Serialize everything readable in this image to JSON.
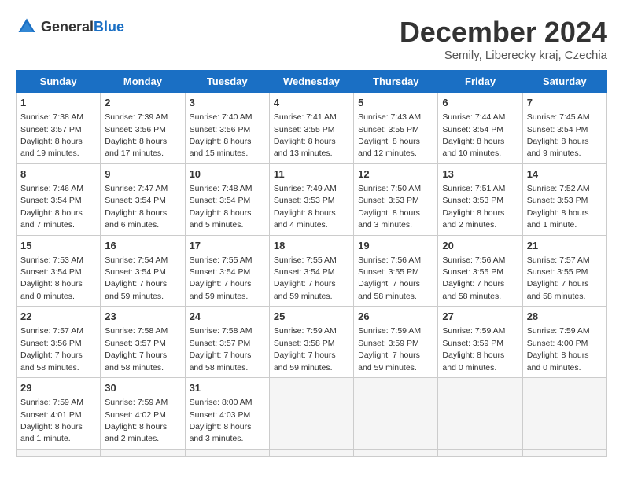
{
  "header": {
    "logo_general": "General",
    "logo_blue": "Blue",
    "title": "December 2024",
    "subtitle": "Semily, Liberecky kraj, Czechia"
  },
  "calendar": {
    "weekdays": [
      "Sunday",
      "Monday",
      "Tuesday",
      "Wednesday",
      "Thursday",
      "Friday",
      "Saturday"
    ],
    "weeks": [
      [
        null,
        null,
        null,
        null,
        null,
        null,
        null
      ]
    ],
    "days": {
      "1": {
        "sunrise": "7:38 AM",
        "sunset": "3:57 PM",
        "daylight": "8 hours and 19 minutes."
      },
      "2": {
        "sunrise": "7:39 AM",
        "sunset": "3:56 PM",
        "daylight": "8 hours and 17 minutes."
      },
      "3": {
        "sunrise": "7:40 AM",
        "sunset": "3:56 PM",
        "daylight": "8 hours and 15 minutes."
      },
      "4": {
        "sunrise": "7:41 AM",
        "sunset": "3:55 PM",
        "daylight": "8 hours and 13 minutes."
      },
      "5": {
        "sunrise": "7:43 AM",
        "sunset": "3:55 PM",
        "daylight": "8 hours and 12 minutes."
      },
      "6": {
        "sunrise": "7:44 AM",
        "sunset": "3:54 PM",
        "daylight": "8 hours and 10 minutes."
      },
      "7": {
        "sunrise": "7:45 AM",
        "sunset": "3:54 PM",
        "daylight": "8 hours and 9 minutes."
      },
      "8": {
        "sunrise": "7:46 AM",
        "sunset": "3:54 PM",
        "daylight": "8 hours and 7 minutes."
      },
      "9": {
        "sunrise": "7:47 AM",
        "sunset": "3:54 PM",
        "daylight": "8 hours and 6 minutes."
      },
      "10": {
        "sunrise": "7:48 AM",
        "sunset": "3:54 PM",
        "daylight": "8 hours and 5 minutes."
      },
      "11": {
        "sunrise": "7:49 AM",
        "sunset": "3:53 PM",
        "daylight": "8 hours and 4 minutes."
      },
      "12": {
        "sunrise": "7:50 AM",
        "sunset": "3:53 PM",
        "daylight": "8 hours and 3 minutes."
      },
      "13": {
        "sunrise": "7:51 AM",
        "sunset": "3:53 PM",
        "daylight": "8 hours and 2 minutes."
      },
      "14": {
        "sunrise": "7:52 AM",
        "sunset": "3:53 PM",
        "daylight": "8 hours and 1 minute."
      },
      "15": {
        "sunrise": "7:53 AM",
        "sunset": "3:54 PM",
        "daylight": "8 hours and 0 minutes."
      },
      "16": {
        "sunrise": "7:54 AM",
        "sunset": "3:54 PM",
        "daylight": "7 hours and 59 minutes."
      },
      "17": {
        "sunrise": "7:55 AM",
        "sunset": "3:54 PM",
        "daylight": "7 hours and 59 minutes."
      },
      "18": {
        "sunrise": "7:55 AM",
        "sunset": "3:54 PM",
        "daylight": "7 hours and 59 minutes."
      },
      "19": {
        "sunrise": "7:56 AM",
        "sunset": "3:55 PM",
        "daylight": "7 hours and 58 minutes."
      },
      "20": {
        "sunrise": "7:56 AM",
        "sunset": "3:55 PM",
        "daylight": "7 hours and 58 minutes."
      },
      "21": {
        "sunrise": "7:57 AM",
        "sunset": "3:55 PM",
        "daylight": "7 hours and 58 minutes."
      },
      "22": {
        "sunrise": "7:57 AM",
        "sunset": "3:56 PM",
        "daylight": "7 hours and 58 minutes."
      },
      "23": {
        "sunrise": "7:58 AM",
        "sunset": "3:57 PM",
        "daylight": "7 hours and 58 minutes."
      },
      "24": {
        "sunrise": "7:58 AM",
        "sunset": "3:57 PM",
        "daylight": "7 hours and 58 minutes."
      },
      "25": {
        "sunrise": "7:59 AM",
        "sunset": "3:58 PM",
        "daylight": "7 hours and 59 minutes."
      },
      "26": {
        "sunrise": "7:59 AM",
        "sunset": "3:59 PM",
        "daylight": "7 hours and 59 minutes."
      },
      "27": {
        "sunrise": "7:59 AM",
        "sunset": "3:59 PM",
        "daylight": "8 hours and 0 minutes."
      },
      "28": {
        "sunrise": "7:59 AM",
        "sunset": "4:00 PM",
        "daylight": "8 hours and 0 minutes."
      },
      "29": {
        "sunrise": "7:59 AM",
        "sunset": "4:01 PM",
        "daylight": "8 hours and 1 minute."
      },
      "30": {
        "sunrise": "7:59 AM",
        "sunset": "4:02 PM",
        "daylight": "8 hours and 2 minutes."
      },
      "31": {
        "sunrise": "8:00 AM",
        "sunset": "4:03 PM",
        "daylight": "8 hours and 3 minutes."
      }
    }
  }
}
